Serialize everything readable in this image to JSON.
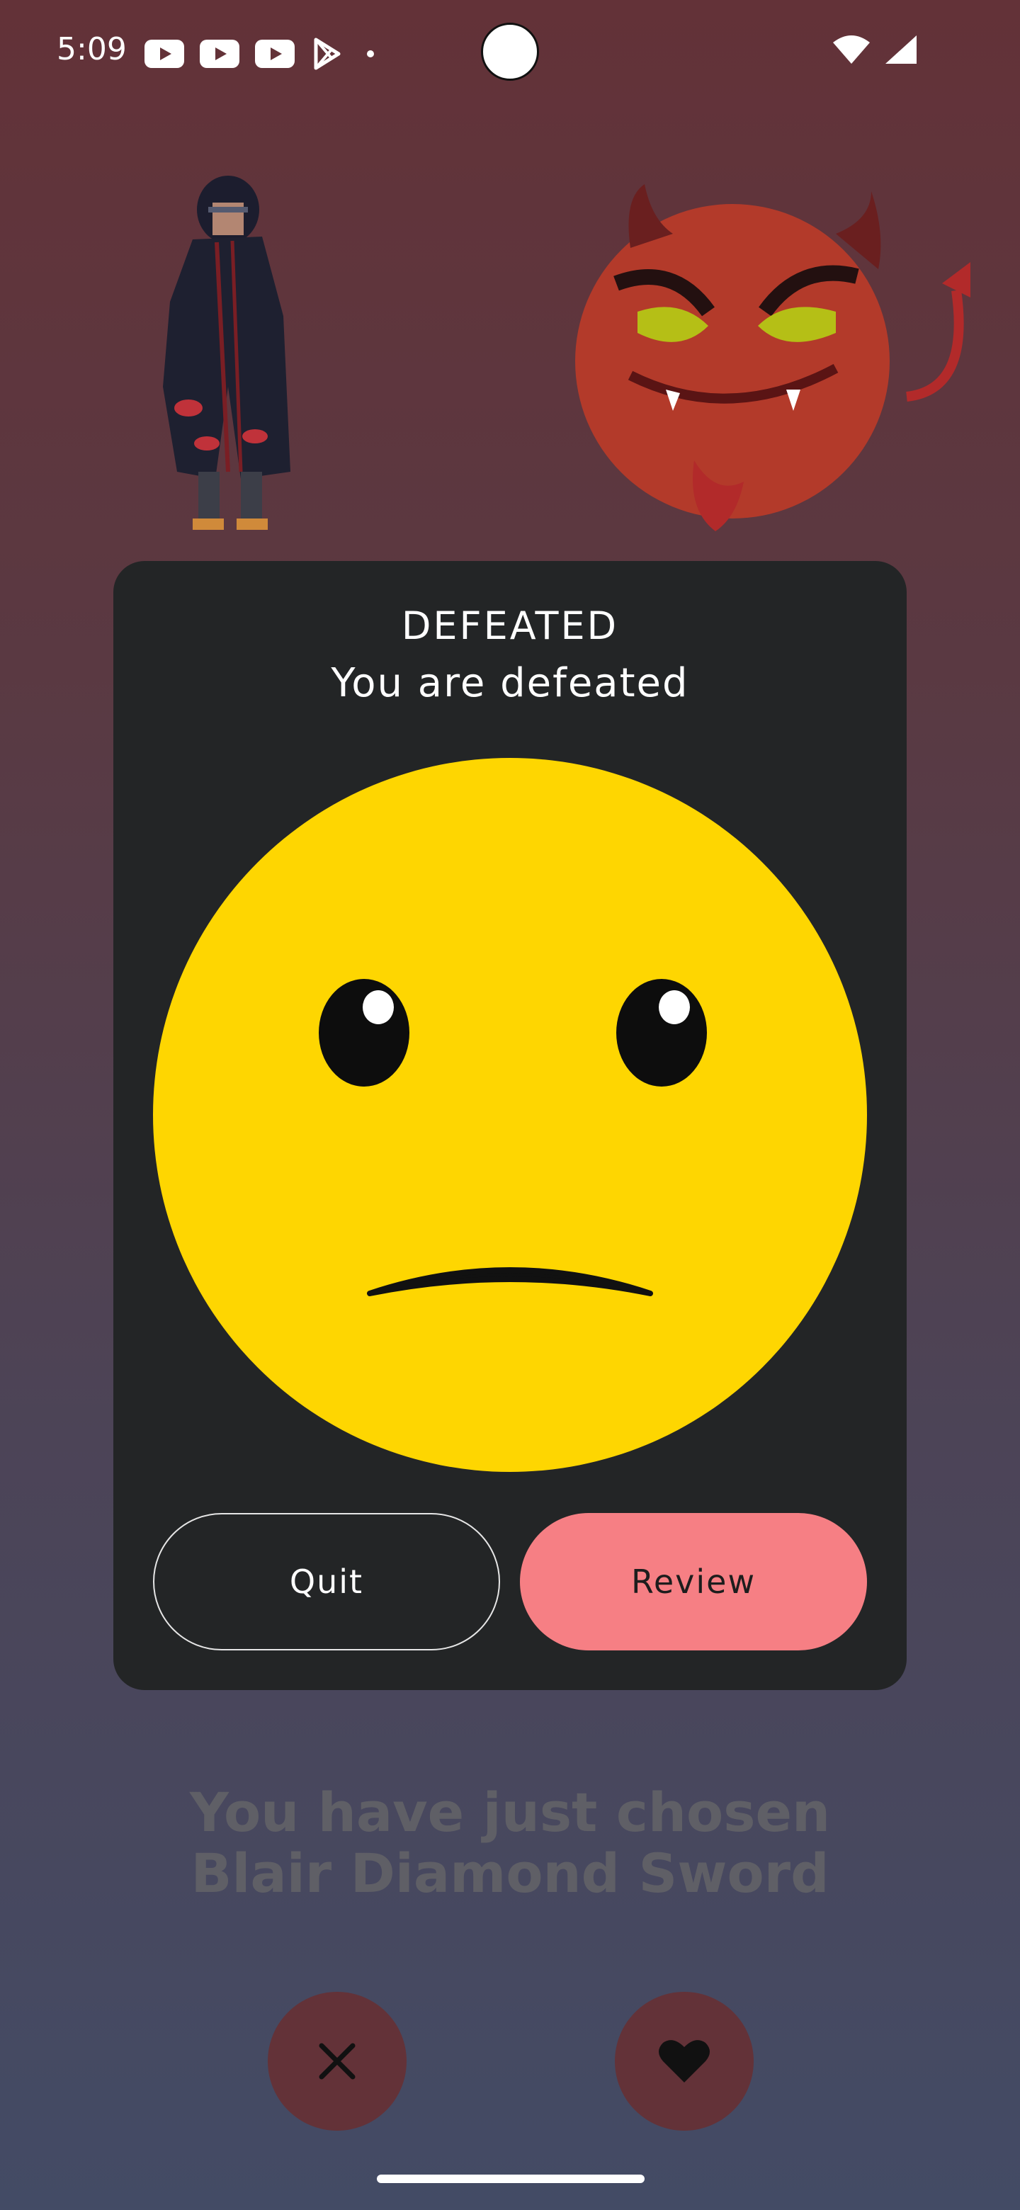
{
  "status_bar": {
    "time": "5:09",
    "notification_icons": [
      "youtube-icon",
      "youtube-icon",
      "youtube-icon",
      "play-store-icon",
      "dot-icon"
    ],
    "right_icons": [
      "wifi-icon",
      "signal-icon"
    ]
  },
  "result_dialog": {
    "title": "DEFEATED",
    "message": "You are defeated",
    "face_icon": "sad-face-icon",
    "quit_label": "Quit",
    "review_label": "Review",
    "colors": {
      "background": "#232526",
      "review": "#f67f84",
      "face": "#fed601"
    }
  },
  "chosen_text": {
    "line1": "You have just chosen",
    "line2": "Blair Diamond Sword"
  },
  "actions": {
    "dismiss_icon": "close-icon",
    "like_icon": "heart-icon",
    "button_color": "#633238"
  }
}
